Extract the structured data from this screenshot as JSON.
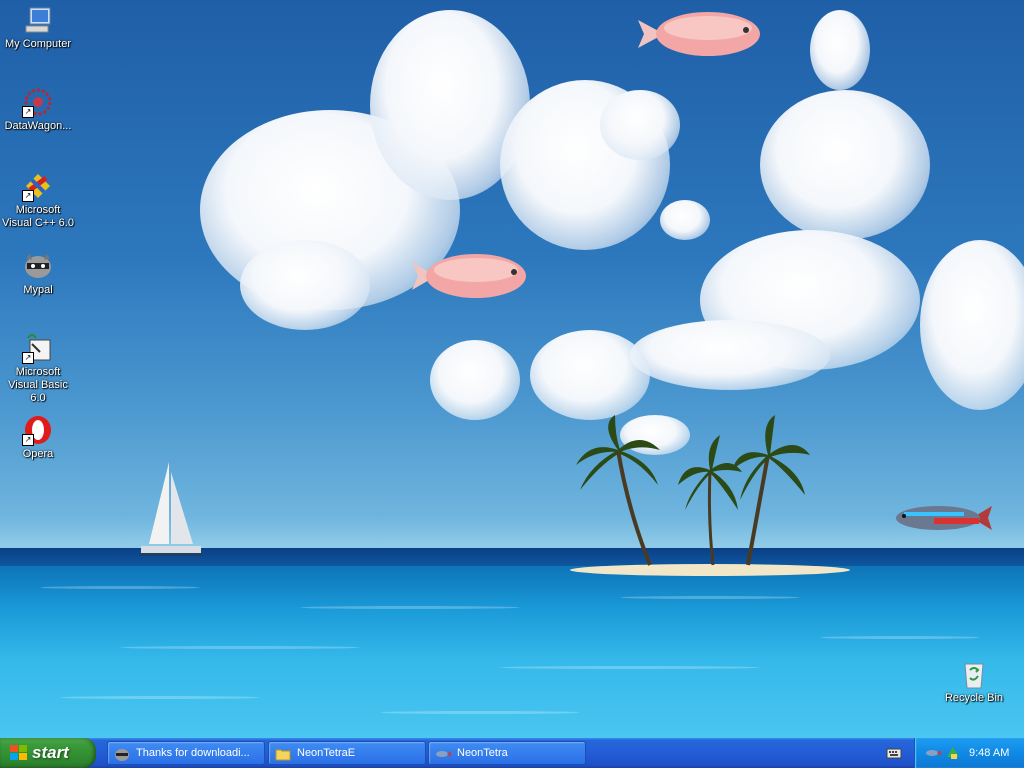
{
  "desktop_icons": [
    {
      "id": "my-computer",
      "label": "My Computer"
    },
    {
      "id": "datawagon",
      "label": "DataWagon..."
    },
    {
      "id": "msvc",
      "label": "Microsoft Visual C++ 6.0"
    },
    {
      "id": "mypal",
      "label": "Mypal"
    },
    {
      "id": "msvb",
      "label": "Microsoft Visual Basic 6.0"
    },
    {
      "id": "opera",
      "label": "Opera"
    },
    {
      "id": "recycle-bin",
      "label": "Recycle Bin"
    }
  ],
  "taskbar": {
    "start_label": "start",
    "buttons": [
      {
        "label": "Thanks for downloadi...",
        "icon": "raccoon-icon"
      },
      {
        "label": "NeonTetraE",
        "icon": "folder-icon"
      },
      {
        "label": "NeonTetra",
        "icon": "fish-icon"
      }
    ],
    "clock": "9:48 AM"
  },
  "colors": {
    "taskbar_blue": "#245dd7",
    "start_green": "#3c9b3c",
    "tray_blue": "#0f8ae6"
  }
}
